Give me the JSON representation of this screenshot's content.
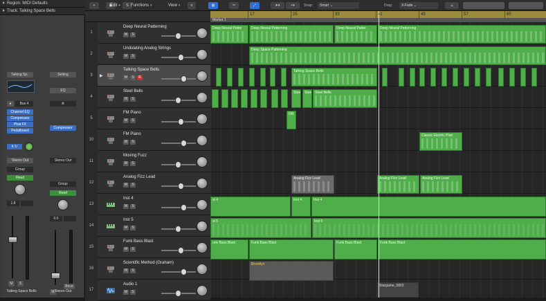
{
  "inspector": {
    "region_header": "Region: MIDI Defaults",
    "track_header": "Track: Talking Space Bells",
    "strip1": {
      "setting": "Talking Sp..",
      "bus": "Bus 4",
      "plugins": [
        "Channel EQ",
        "Compressor",
        "Phat FX",
        "Pedalboard"
      ],
      "io": "Ⅱ ↻",
      "output": "Stereo Out",
      "group": "Group",
      "automation": "Read",
      "value": "1.8",
      "mute": "M",
      "solo": "S",
      "name": "Talking Space Bells"
    },
    "strip2": {
      "setting": "Setting",
      "eq": "EQ",
      "io": "Ⅲ",
      "plugins": [
        "Compressor"
      ],
      "output": "Stereo Out",
      "group": "Group",
      "automation": "Read",
      "value": "0.0",
      "mute": "M",
      "bnce": "Bnce",
      "name": "Stereo Out"
    }
  },
  "toolbar": {
    "add_icon": "+",
    "s_btn": "S",
    "edit": "Edit",
    "functions": "Functions",
    "view": "View",
    "snap_label": "Snap:",
    "snap_value": "Smart",
    "drag_label": "Drag:",
    "drag_value": "X-Fade"
  },
  "ruler": {
    "bars": [
      "17",
      "25",
      "33",
      "41",
      "49",
      "57",
      "65"
    ],
    "marker": "Marker 1"
  },
  "tracks": [
    {
      "num": "1",
      "name": "Deep Neural Patterning",
      "btns": [
        "M",
        "S"
      ]
    },
    {
      "num": "2",
      "name": "Undulating Analog Strings",
      "btns": [
        "M",
        "S"
      ]
    },
    {
      "num": "3",
      "name": "Talking Space Bells",
      "btns": [
        "M",
        "S",
        "R"
      ]
    },
    {
      "num": "4",
      "name": "Steel Bells",
      "btns": [
        "M",
        "S"
      ]
    },
    {
      "num": "5",
      "name": "FM Piano",
      "btns": [
        "M",
        "S"
      ]
    },
    {
      "num": "10",
      "name": "FM Piano",
      "btns": [
        "M",
        "S"
      ]
    },
    {
      "num": "11",
      "name": "Moving Fuzz",
      "btns": [
        "M",
        "S"
      ]
    },
    {
      "num": "12",
      "name": "Analog Fizz Lead",
      "btns": [
        "M",
        "S"
      ]
    },
    {
      "num": "13",
      "name": "Inst 4",
      "btns": [
        "M",
        "S"
      ]
    },
    {
      "num": "14",
      "name": "Inst 5",
      "btns": [
        "M",
        "S"
      ]
    },
    {
      "num": "15",
      "name": "Funk Bass Blast",
      "btns": [
        "M",
        "S"
      ]
    },
    {
      "num": "16",
      "name": "Scientific Method (Graham)",
      "btns": [
        "M",
        "S"
      ]
    },
    {
      "num": "17",
      "name": "Audio 1",
      "btns": [
        "M",
        "S"
      ]
    }
  ],
  "regions": {
    "r1a": "Deep Neural Patter",
    "r1b": "Deep Neural Patterning",
    "r1c": "Deep Neural Patter",
    "r1d": "Deep Neural Patterning",
    "r2": "Deep Space Patterning",
    "r3": "Talking Space Bells",
    "r4a": "Stee",
    "r4b": "Stee",
    "r4c": "Steel Bells",
    "r5": "FM",
    "r10": "Classic Electric Pian",
    "r12a": "Analog Fizz Lead",
    "r12b": "Analog Fizz Lead",
    "r12c": "Analog Fizz Lead",
    "r13a": "st 4",
    "r13b": "Inst 4",
    "r13c": "Inst 4",
    "r14a": "st 5",
    "r14b": "Inst 5",
    "r15a": "unk Bass Blast",
    "r15b": "Funk Bass Blast",
    "r15c": "Funk Bass Blast",
    "r15d": "Funk Bass Blast",
    "r16": "Brooklyn",
    "r17": "Stargame_0803"
  }
}
